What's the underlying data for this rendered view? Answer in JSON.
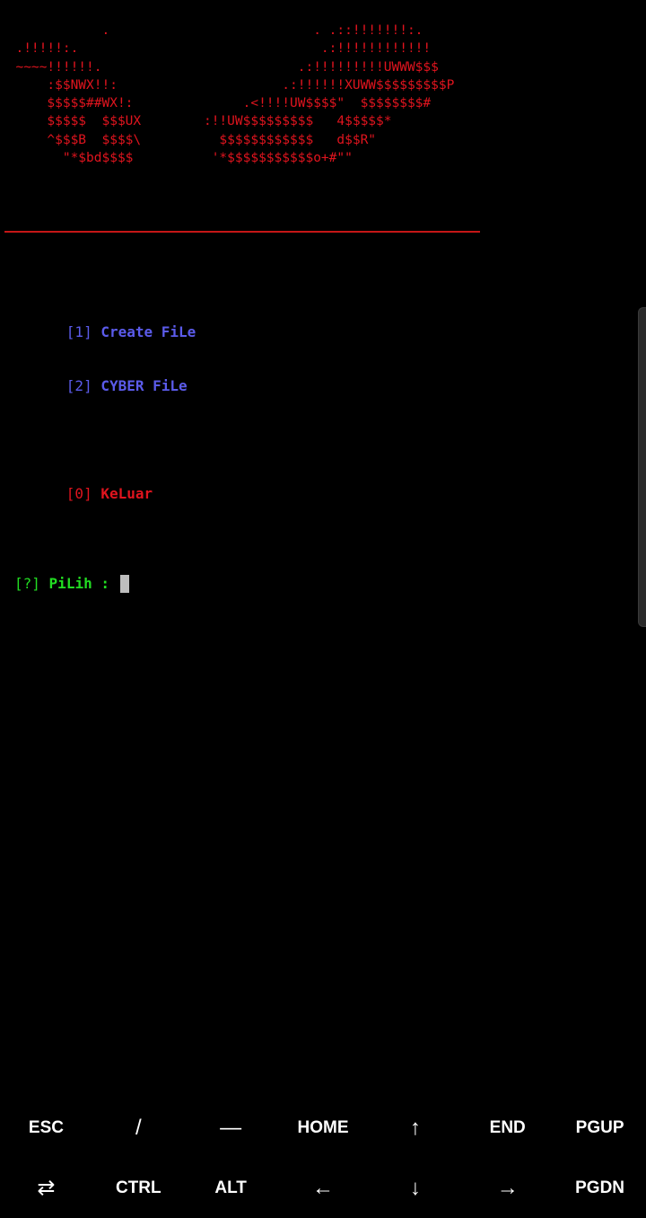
{
  "colors": {
    "background": "#000000",
    "banner_red": "#e0141e",
    "divider_red": "#c51616",
    "menu_blue": "#5b5bea",
    "exit_red": "#e0141e",
    "prompt_green": "#22dd22",
    "cursor_gray": "#bdbdbd",
    "key_text": "#ffffff"
  },
  "banner": {
    "ascii_art": "             .                          . .::!!!!!!!:.\n  .!!!!!:.                               .:!!!!!!!!!!!!\n  ~~~~!!!!!!.                         .:!!!!!!!!!UWWW$$$\n      :$$NWX!!:                     .:!!!!!!XUWW$$$$$$$$$P\n      $$$$$##WX!:              .<!!!!UW$$$$\"  $$$$$$$$#\n      $$$$$  $$$UX        :!!UW$$$$$$$$$   4$$$$$*\n      ^$$$B  $$$$\\          $$$$$$$$$$$$   d$$R\"\n        \"*$bd$$$$          '*$$$$$$$$$$$o+#\"\""
  },
  "menu": {
    "items": [
      {
        "key": "[1]",
        "label": "Create FiLe"
      },
      {
        "key": "[2]",
        "label": "CYBER FiLe"
      }
    ],
    "exit": {
      "key": "[0]",
      "label": "KeLuar"
    },
    "prompt": {
      "key": "[?]",
      "label": "PiLih :"
    }
  },
  "extra_keys": {
    "row1": [
      {
        "label": "ESC",
        "icon": ""
      },
      {
        "label": "/",
        "icon": ""
      },
      {
        "label": "—",
        "icon": ""
      },
      {
        "label": "HOME",
        "icon": ""
      },
      {
        "label": "↑",
        "icon": "arrow-up-icon"
      },
      {
        "label": "END",
        "icon": ""
      },
      {
        "label": "PGUP",
        "icon": ""
      }
    ],
    "row2": [
      {
        "label": "⇄",
        "icon": "tab-icon"
      },
      {
        "label": "CTRL",
        "icon": ""
      },
      {
        "label": "ALT",
        "icon": ""
      },
      {
        "label": "←",
        "icon": "arrow-left-icon"
      },
      {
        "label": "↓",
        "icon": "arrow-down-icon"
      },
      {
        "label": "→",
        "icon": "arrow-right-icon"
      },
      {
        "label": "PGDN",
        "icon": ""
      }
    ]
  }
}
